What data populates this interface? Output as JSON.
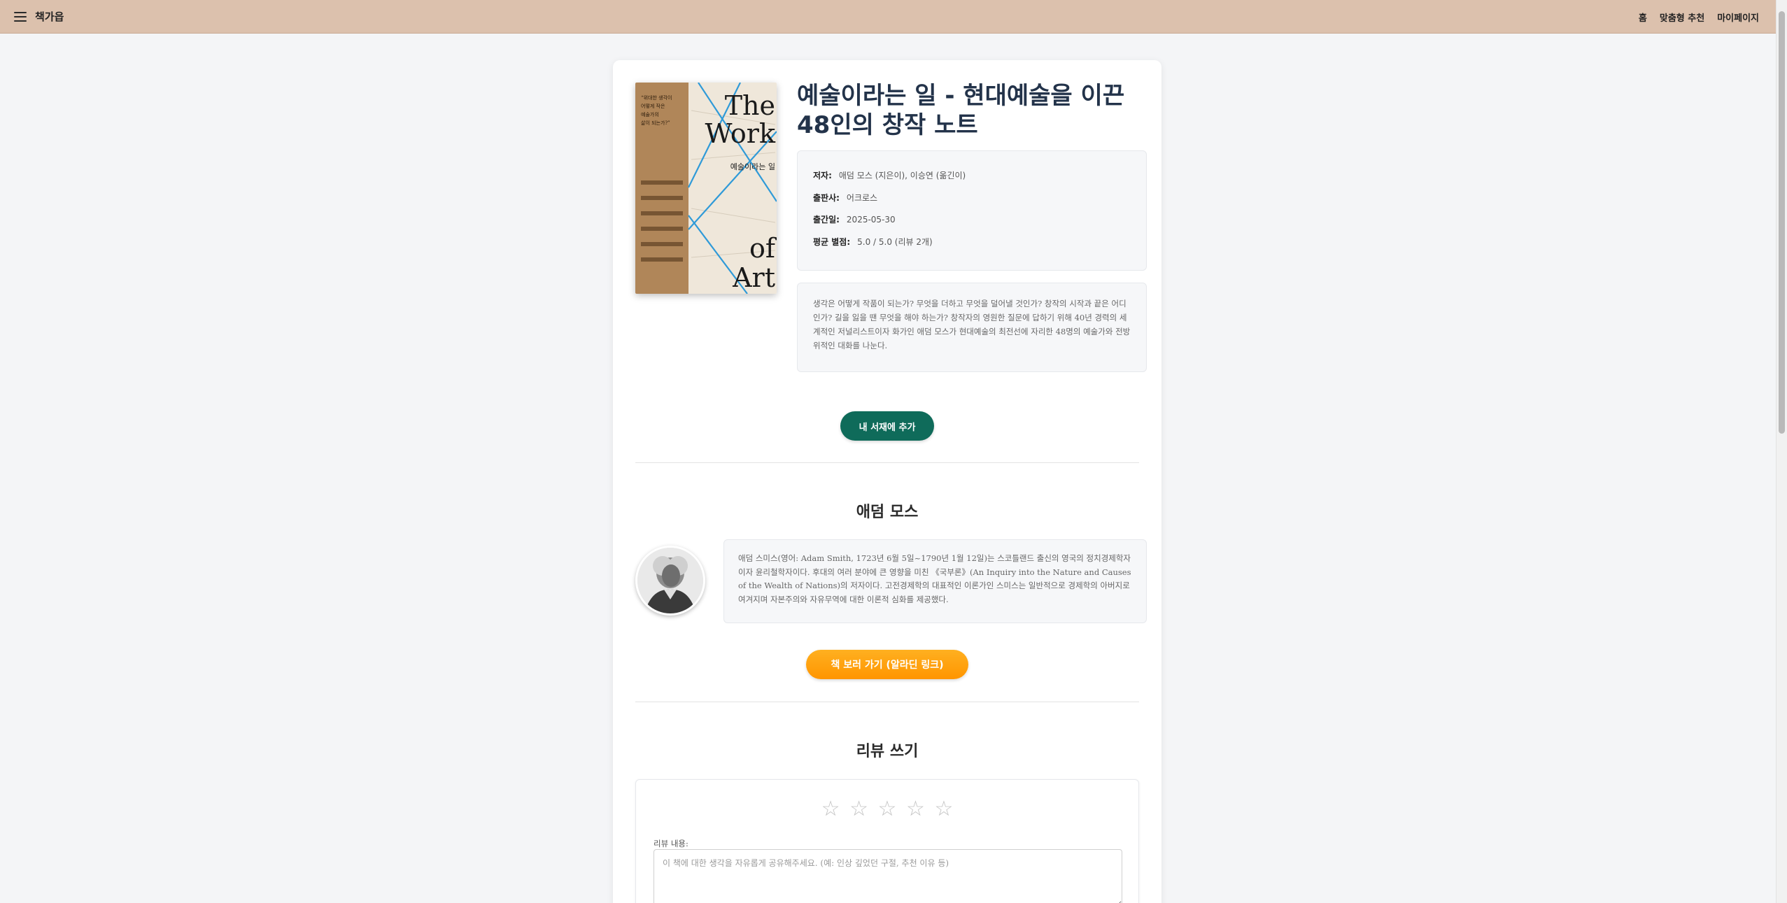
{
  "nav": {
    "brand": "책가읍",
    "links": [
      "홈",
      "맞춤형 추천",
      "마이페이지"
    ]
  },
  "book": {
    "title": "예술이라는 일 - 현대예술을 이끈 48인의 창작 노트",
    "cover_text": {
      "en_title": "The Work of Art",
      "ko_title": "예술이라는 일",
      "quote": "“위대한 생각이 어떻게 작은 예술가의 삶이 되는가?”"
    },
    "meta": [
      {
        "label": "저자:",
        "value": "애덤 모스 (지은이), 이승연 (옮긴이)"
      },
      {
        "label": "출판사:",
        "value": "어크로스"
      },
      {
        "label": "출간일:",
        "value": "2025-05-30"
      },
      {
        "label": "평균 별점:",
        "value": "5.0 / 5.0 (리뷰 2개)"
      }
    ],
    "description": "생각은 어떻게 작품이 되는가? 무엇을 더하고 무엇을 덜어낼 것인가? 창작의 시작과 끝은 어디인가? 길을 잃을 땐 무엇을 해야 하는가? 창작자의 영원한 질문에 답하기 위해 40년 경력의 세계적인 저널리스트이자 화가인 애덤 모스가 현대예술의 최전선에 자리한 48명의 예술가와 전방위적인 대화를 나눈다.",
    "add_button": "내 서재에 추가"
  },
  "author": {
    "section_title": "애덤 모스",
    "bio": "애덤 스미스(영어: Adam Smith, 1723년 6월 5일~1790년 1월 12일)는 스코틀랜드 출신의 영국의 정치경제학자이자 윤리철학자이다. 후대의 여러 분야에 큰 영향을 미친 《국부론》(An Inquiry into the Nature and Causes of the Wealth of Nations)의 저자이다. 고전경제학의 대표적인 이론가인 스미스는 일반적으로 경제학의 아버지로 여겨지며 자본주의와 자유무역에 대한 이론적 심화를 제공했다.",
    "link_button": "책 보러 가기 (알라딘 링크)"
  },
  "review": {
    "section_title": "리뷰 쓰기",
    "stars": [
      "☆",
      "☆",
      "☆",
      "☆",
      "☆"
    ],
    "rating": 0,
    "label": "리뷰 내용:",
    "placeholder": "이 책에 대한 생각을 자유롭게 공유해주세요. (예: 인상 깊었던 구절, 추천 이유 등)",
    "value": ""
  },
  "colors": {
    "topbar": "#dcc1ad",
    "primary_button": "#0f6b5a",
    "link_button": "#ff9f10",
    "title": "#23334a"
  }
}
